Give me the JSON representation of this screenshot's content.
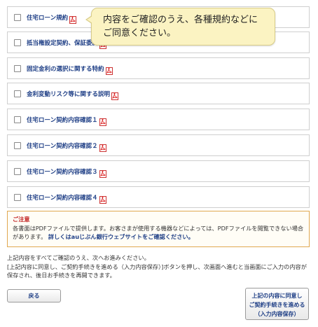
{
  "documents": [
    {
      "label": "住宅ローン規約"
    },
    {
      "label": "抵当権設定契約、保証委託"
    },
    {
      "label": "固定金利の選択に関する特約"
    },
    {
      "label": "金利変動リスク等に関する説明"
    },
    {
      "label": "住宅ローン契約内容確認１"
    },
    {
      "label": "住宅ローン契約内容確認２"
    },
    {
      "label": "住宅ローン契約内容確認３"
    },
    {
      "label": "住宅ローン契約内容確認４"
    }
  ],
  "tooltip": {
    "line1": "内容をご確認のうえ、各種規約などに",
    "line2": "ご同意ください。"
  },
  "notice": {
    "title": "ご注意",
    "body": "各書面はPDFファイルで提供します。お客さまが使用する機器などによっては、PDFファイルを閲覧できない場合があります。",
    "link": "詳しくはauじぶん銀行ウェブサイトをご確認ください。"
  },
  "instructions": {
    "line1": "上記内容をすべてご確認のうえ、次へお進みください。",
    "line2": "[上記内容に同意し、ご契約手続きを進める（入力内容保存）]ボタンを押し、次画面へ進むと当画面にご入力の内容が保存され、後日お手続きを再開できます。"
  },
  "buttons": {
    "back": "戻る",
    "next_line1": "上記の内容に同意し",
    "next_line2": "ご契約手続きを進める",
    "next_line3": "（入力内容保存）"
  },
  "colors": {
    "link_blue": "#1f3f86",
    "tooltip_bg": "#fbf3c2",
    "notice_border": "#e0a850",
    "notice_title": "#c02020",
    "pdf_red": "#d22"
  }
}
